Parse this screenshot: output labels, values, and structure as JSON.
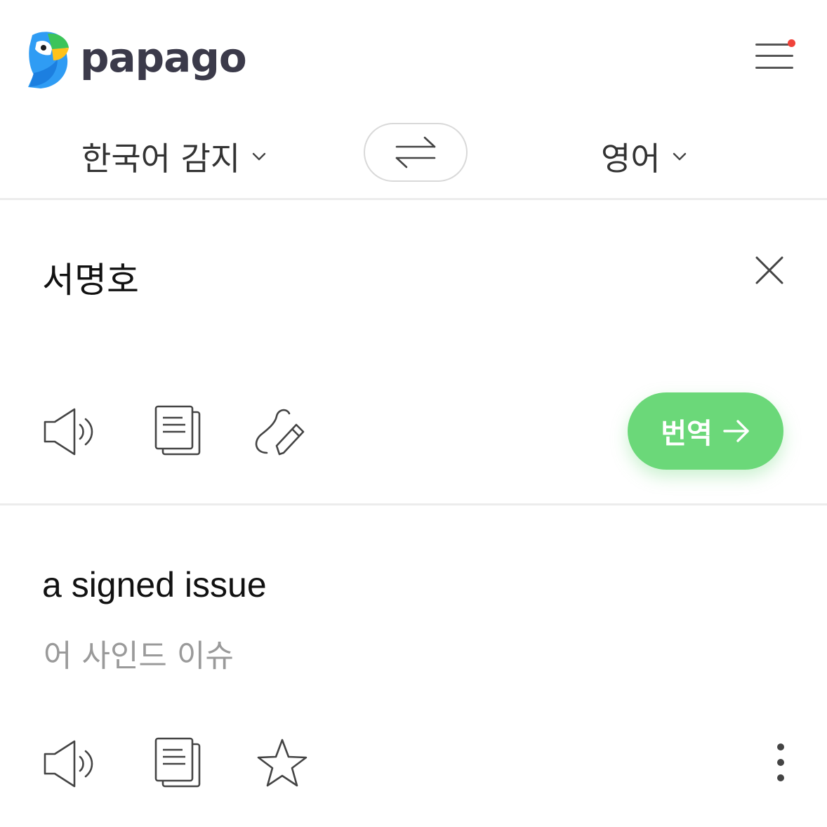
{
  "header": {
    "brand": "papago",
    "menu_has_notification": true
  },
  "language_bar": {
    "source_language": "한국어 감지",
    "target_language": "영어"
  },
  "source": {
    "text": "서명호",
    "translate_label": "번역"
  },
  "result": {
    "text": "a signed issue",
    "pronunciation": "어 사인드 이슈"
  },
  "icons": {
    "logo": "papago-parrot-icon",
    "menu": "hamburger-menu-icon",
    "swap": "swap-arrows-icon",
    "clear": "close-icon",
    "speaker": "speaker-icon",
    "copy": "copy-icon",
    "handwriting": "handwriting-pen-icon",
    "arrow": "arrow-right-icon",
    "favorite": "star-icon",
    "more": "more-vertical-icon"
  },
  "colors": {
    "accent": "#6bd879",
    "notification": "#f0433a",
    "brand_text": "#3b3a4a",
    "muted": "#9a9a9a"
  }
}
